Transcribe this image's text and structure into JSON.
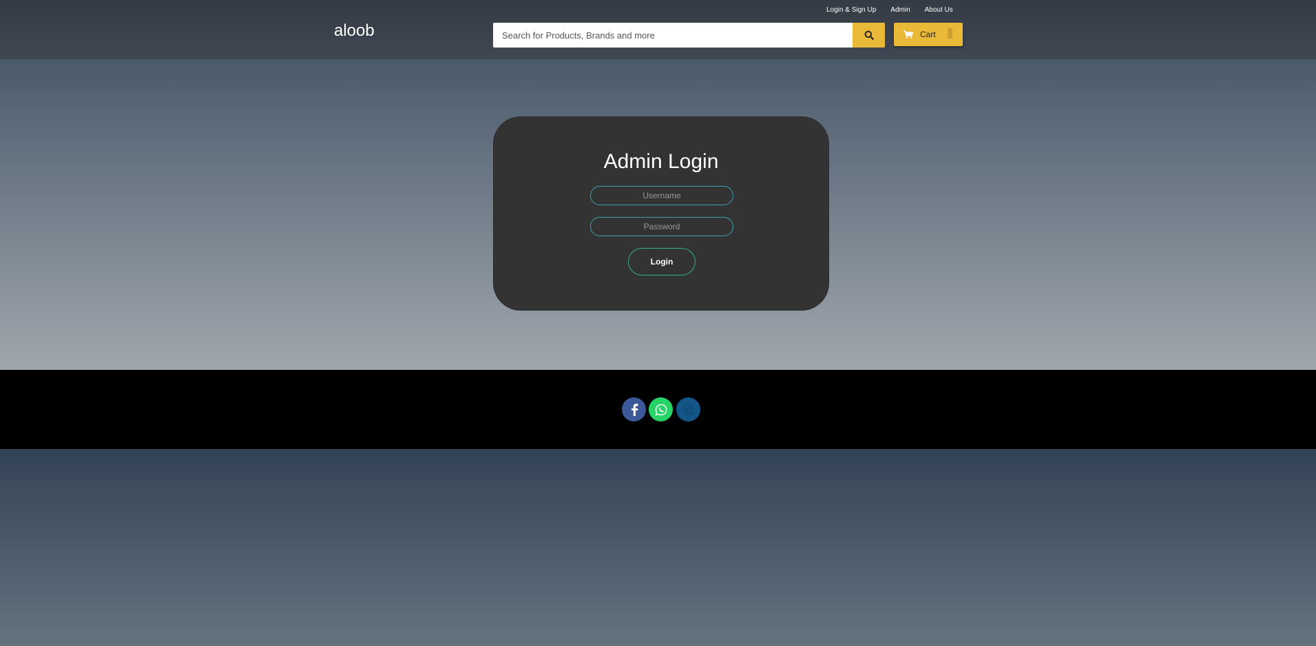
{
  "header": {
    "logo": "aloob",
    "top_links": [
      "Login & Sign Up",
      "Admin",
      "About Us"
    ],
    "search": {
      "placeholder": "Search for Products, Brands and more",
      "value": ""
    },
    "cart": {
      "label": "Cart"
    }
  },
  "login": {
    "title": "Admin Login",
    "username_placeholder": "Username",
    "password_placeholder": "Password",
    "button_label": "Login"
  },
  "footer": {
    "social": [
      "facebook-icon",
      "whatsapp-icon",
      "instagram-icon"
    ]
  },
  "colors": {
    "accent": "#e9b937",
    "card": "#333333",
    "field_border": "#3aa0b0",
    "button_border": "#2fb08a",
    "facebook": "#3b5998",
    "whatsapp": "#25d366",
    "instagram": "#125688"
  }
}
